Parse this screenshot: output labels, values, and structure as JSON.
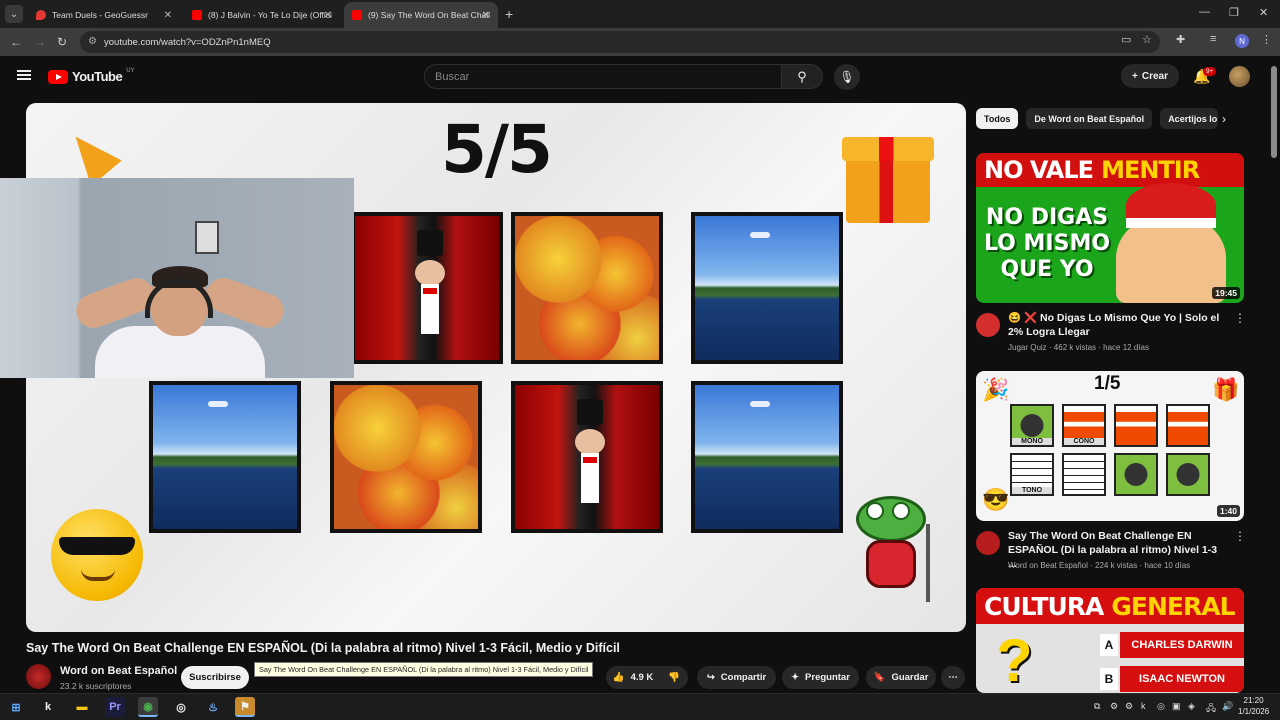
{
  "browser": {
    "tabs": [
      {
        "title": "Team Duels - GeoGuessr",
        "favicon_color": "#e53935",
        "active": false
      },
      {
        "title": "(8) J Balvin - Yo Te Lo Dije (Offici",
        "favicon_color": "#ff0000",
        "active": false
      },
      {
        "title": "(9) Say The Word On Beat Chall",
        "favicon_color": "#ff0000",
        "active": true
      }
    ],
    "url": "youtube.com/watch?v=ODZnPn1nMEQ",
    "profile_initial": "N"
  },
  "youtube": {
    "logo_text": "YouTube",
    "country_code": "UY",
    "search_placeholder": "Buscar",
    "create_label": "Crear",
    "notifications_badge": "9+"
  },
  "video": {
    "score_text": "5/5",
    "grid": [
      [
        "magician",
        "mango",
        "lake"
      ],
      [
        "lake",
        "mango",
        "magician",
        "lake"
      ]
    ]
  },
  "watch": {
    "title": "Say The Word On Beat Challenge EN ESPAÑOL (Di la palabra al ritmo) Nivel 1-3 Fácil, Medio y Difícil",
    "channel_name": "Word on Beat Español",
    "subscribers": "23.2 k suscriptores",
    "subscribe_label": "Suscribirse",
    "tooltip": "Say The Word On Beat Challenge EN ESPAÑOL (Di la palabra al ritmo) Nivel 1-3 Fácil, Medio y Difícil",
    "likes": "4.9 K",
    "share_label": "Compartir",
    "ask_label": "Preguntar",
    "save_label": "Guardar"
  },
  "sidebar": {
    "chips": [
      "Todos",
      "De Word on Beat Español",
      "Acertijos lo"
    ],
    "videos": [
      {
        "thumb_text_a": "NO VALE",
        "thumb_text_b": "MENTIR",
        "thumb_text_c": "NO DIGAS LO MISMO QUE YO",
        "duration": "19:45",
        "title": "😆 ❌ No Digas Lo Mismo Que Yo | Solo el 2% Logra Llegar",
        "channel": "Jugar Quiz",
        "meta": "462 k vistas · hace 12 días",
        "avatar_color": "#d32f2f"
      },
      {
        "thumb_title": "1/5",
        "thumb_labels": [
          "MONO",
          "CONO",
          "TONO"
        ],
        "duration": "1:40",
        "title": "Say The Word On Beat Challenge EN ESPAÑOL (Di la palabra al ritmo) Nivel 1-3 ...",
        "channel": "Word on Beat Español",
        "meta": "224 k vistas · hace 10 días",
        "avatar_color": "#b71c1c"
      },
      {
        "thumb_text_a": "CULTURA",
        "thumb_text_b": "GENERAL",
        "answer_a_letter": "A",
        "answer_a": "CHARLES DARWIN",
        "answer_b_letter": "B",
        "answer_b": "ISAAC NEWTON"
      }
    ]
  },
  "taskbar": {
    "clock_time": "21:20",
    "clock_date": "1/1/2026",
    "apps": [
      "start",
      "k",
      "files",
      "Pr",
      "chrome",
      "obs",
      "steam",
      "game"
    ]
  }
}
